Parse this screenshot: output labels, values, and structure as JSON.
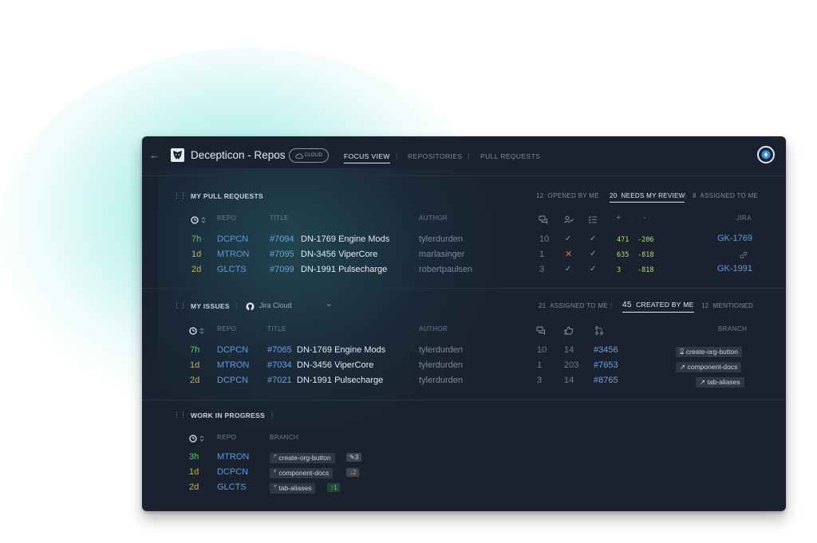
{
  "header": {
    "title": "Decepticon - Repos",
    "cloud_label": "CLOUD",
    "nav": [
      {
        "label": "FOCUS VIEW"
      },
      {
        "label": "REPOSITORIES"
      },
      {
        "label": "PULL REQUESTS"
      }
    ]
  },
  "pull_requests": {
    "title": "MY PULL REQUESTS",
    "filters": [
      {
        "count": "12",
        "label": "OPENED BY ME"
      },
      {
        "count": "20",
        "label": "NEEDS MY REVIEW"
      },
      {
        "count": "8",
        "label": "ASSIGNED TO ME"
      }
    ],
    "columns": {
      "repo": "REPO",
      "title": "TITLE",
      "author": "AUTHOR",
      "plus": "+",
      "minus": "-",
      "jira": "JIRA"
    },
    "rows": [
      {
        "age": "7h",
        "repo": "DCPCN",
        "number": "#7094",
        "title": "DN-1769 Engine Mods",
        "author": "tylerdurden",
        "comments": "10",
        "review": "check",
        "checks": "check",
        "added": "471",
        "removed": "-206",
        "jira": "GK-1769"
      },
      {
        "age": "1d",
        "repo": "MTRON",
        "number": "#7095",
        "title": "DN-3456 ViperCore",
        "author": "marlasinger",
        "comments": "1",
        "review": "x",
        "checks": "check",
        "added": "635",
        "removed": "-818",
        "jira": ""
      },
      {
        "age": "2d",
        "repo": "GLCTS",
        "number": "#7099",
        "title": "DN-1991 Pulsecharge",
        "author": "robertpaulsen",
        "comments": "3",
        "review": "check",
        "checks": "check",
        "added": "3",
        "removed": "-818",
        "jira": "GK-1991"
      }
    ]
  },
  "issues": {
    "title": "MY ISSUES",
    "source": "Jira Cloud",
    "filters": [
      {
        "count": "21",
        "label": "ASSIGNED TO ME"
      },
      {
        "count": "45",
        "label": "CREATED BY ME"
      },
      {
        "count": "12",
        "label": "MENTIONED"
      }
    ],
    "columns": {
      "repo": "REPO",
      "title": "TITLE",
      "author": "AUTHOR",
      "branch": "BRANCH"
    },
    "rows": [
      {
        "age": "7h",
        "repo": "DCPCN",
        "number": "#7065",
        "title": "DN-1769 Engine Mods",
        "author": "tylerdurden",
        "comments": "10",
        "likes": "14",
        "pr": "#3456",
        "branch": "create-org-button"
      },
      {
        "age": "1d",
        "repo": "MTRON",
        "number": "#7034",
        "title": "DN-3456 ViperCore",
        "author": "tylerdurden",
        "comments": "1",
        "likes": "203",
        "pr": "#7653",
        "branch": "component-docs"
      },
      {
        "age": "2d",
        "repo": "DCPCN",
        "number": "#7021",
        "title": "DN-1991 Pulsecharge",
        "author": "tylerdurden",
        "comments": "3",
        "likes": "14",
        "pr": "#8765",
        "branch": "tab-aliases"
      }
    ]
  },
  "wip": {
    "title": "WORK IN PROGRESS",
    "columns": {
      "repo": "REPO",
      "branch": "BRANCH"
    },
    "rows": [
      {
        "age": "3h",
        "repo": "MTRON",
        "branch": "create-org-button",
        "badge": "3",
        "badge_icon": "pencil-icon"
      },
      {
        "age": "1d",
        "repo": "DCPCN",
        "branch": "component-docs",
        "badge": "2",
        "badge_icon": "arrow-down-icon"
      },
      {
        "age": "2d",
        "repo": "GLCTS",
        "branch": "tab-aliases",
        "badge": "1",
        "badge_icon": "arrow-up-icon"
      }
    ]
  },
  "colors": {
    "background": "#1a2230",
    "accent_blue": "#5b9be6",
    "age_fresh": "#4fd35a",
    "age_old": "#c2b64e",
    "error": "#e26d3b",
    "glow": "#40d6cd"
  }
}
